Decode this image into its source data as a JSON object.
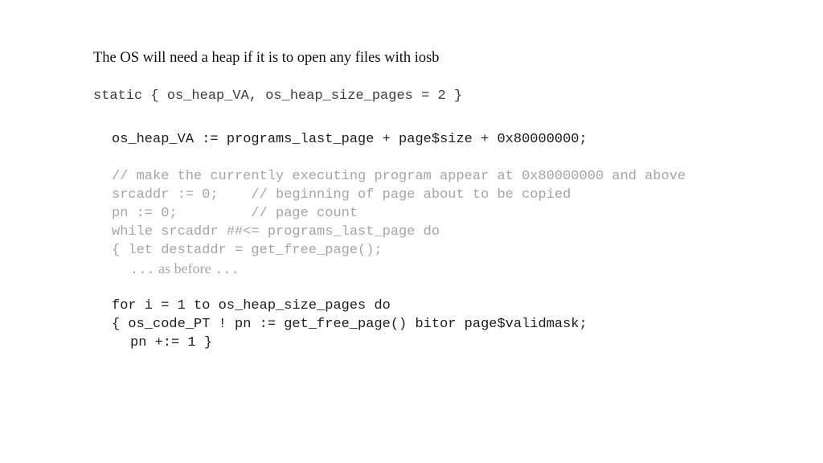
{
  "slide": {
    "heading": "The OS will need a heap if it is to open any files with iosb",
    "static_decl": "static { os_heap_VA, os_heap_size_pages = 2 }",
    "code": {
      "assign_heap_va": "os_heap_VA := programs_last_page + page$size + 0x80000000;",
      "comment_make": "// make the currently executing program appear at 0x80000000 and above",
      "srcaddr_line": "srcaddr := 0;    // beginning of page about to be copied",
      "pn_line": "pn := 0;         // page count",
      "while_line": "while srcaddr ##<= programs_last_page do",
      "let_line": "{ let destaddr = get_free_page();",
      "as_before_dots_left": "...",
      "as_before_text": " as before ",
      "as_before_dots_right": "...",
      "for_line": "for i = 1 to os_heap_size_pages do",
      "os_code_line": "{ os_code_PT ! pn := get_free_page() bitor page$validmask;",
      "pn_inc_line": "pn +:= 1 }"
    }
  }
}
